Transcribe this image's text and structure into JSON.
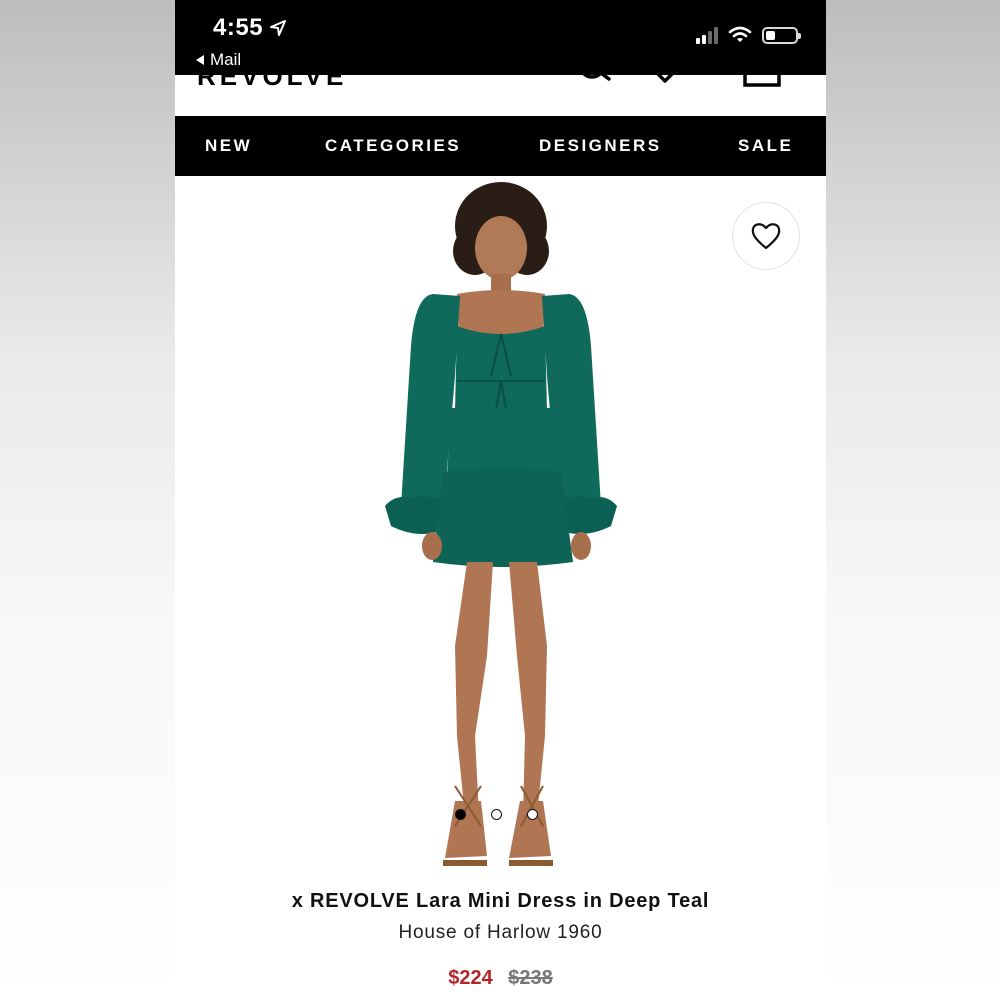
{
  "status_bar": {
    "time": "4:55",
    "back_label": "Mail"
  },
  "header": {
    "logo_text": "REVOLVE"
  },
  "nav": {
    "items": [
      "NEW",
      "CATEGORIES",
      "DESIGNERS",
      "SALE"
    ]
  },
  "product": {
    "title": "x REVOLVE Lara Mini Dress in Deep Teal",
    "brand": "House of Harlow 1960",
    "sale_price": "$224",
    "original_price": "$238",
    "image_count": 3,
    "active_image": 1
  },
  "colors": {
    "sale_price": "#b3252b",
    "dress": "#0f6a5c",
    "nav_bg": "#000000"
  },
  "icons": [
    "location-arrow-icon",
    "back-arrow-icon",
    "signal-icon",
    "wifi-icon",
    "battery-icon",
    "search-icon",
    "chevron-down-icon",
    "bag-icon",
    "heart-icon"
  ]
}
